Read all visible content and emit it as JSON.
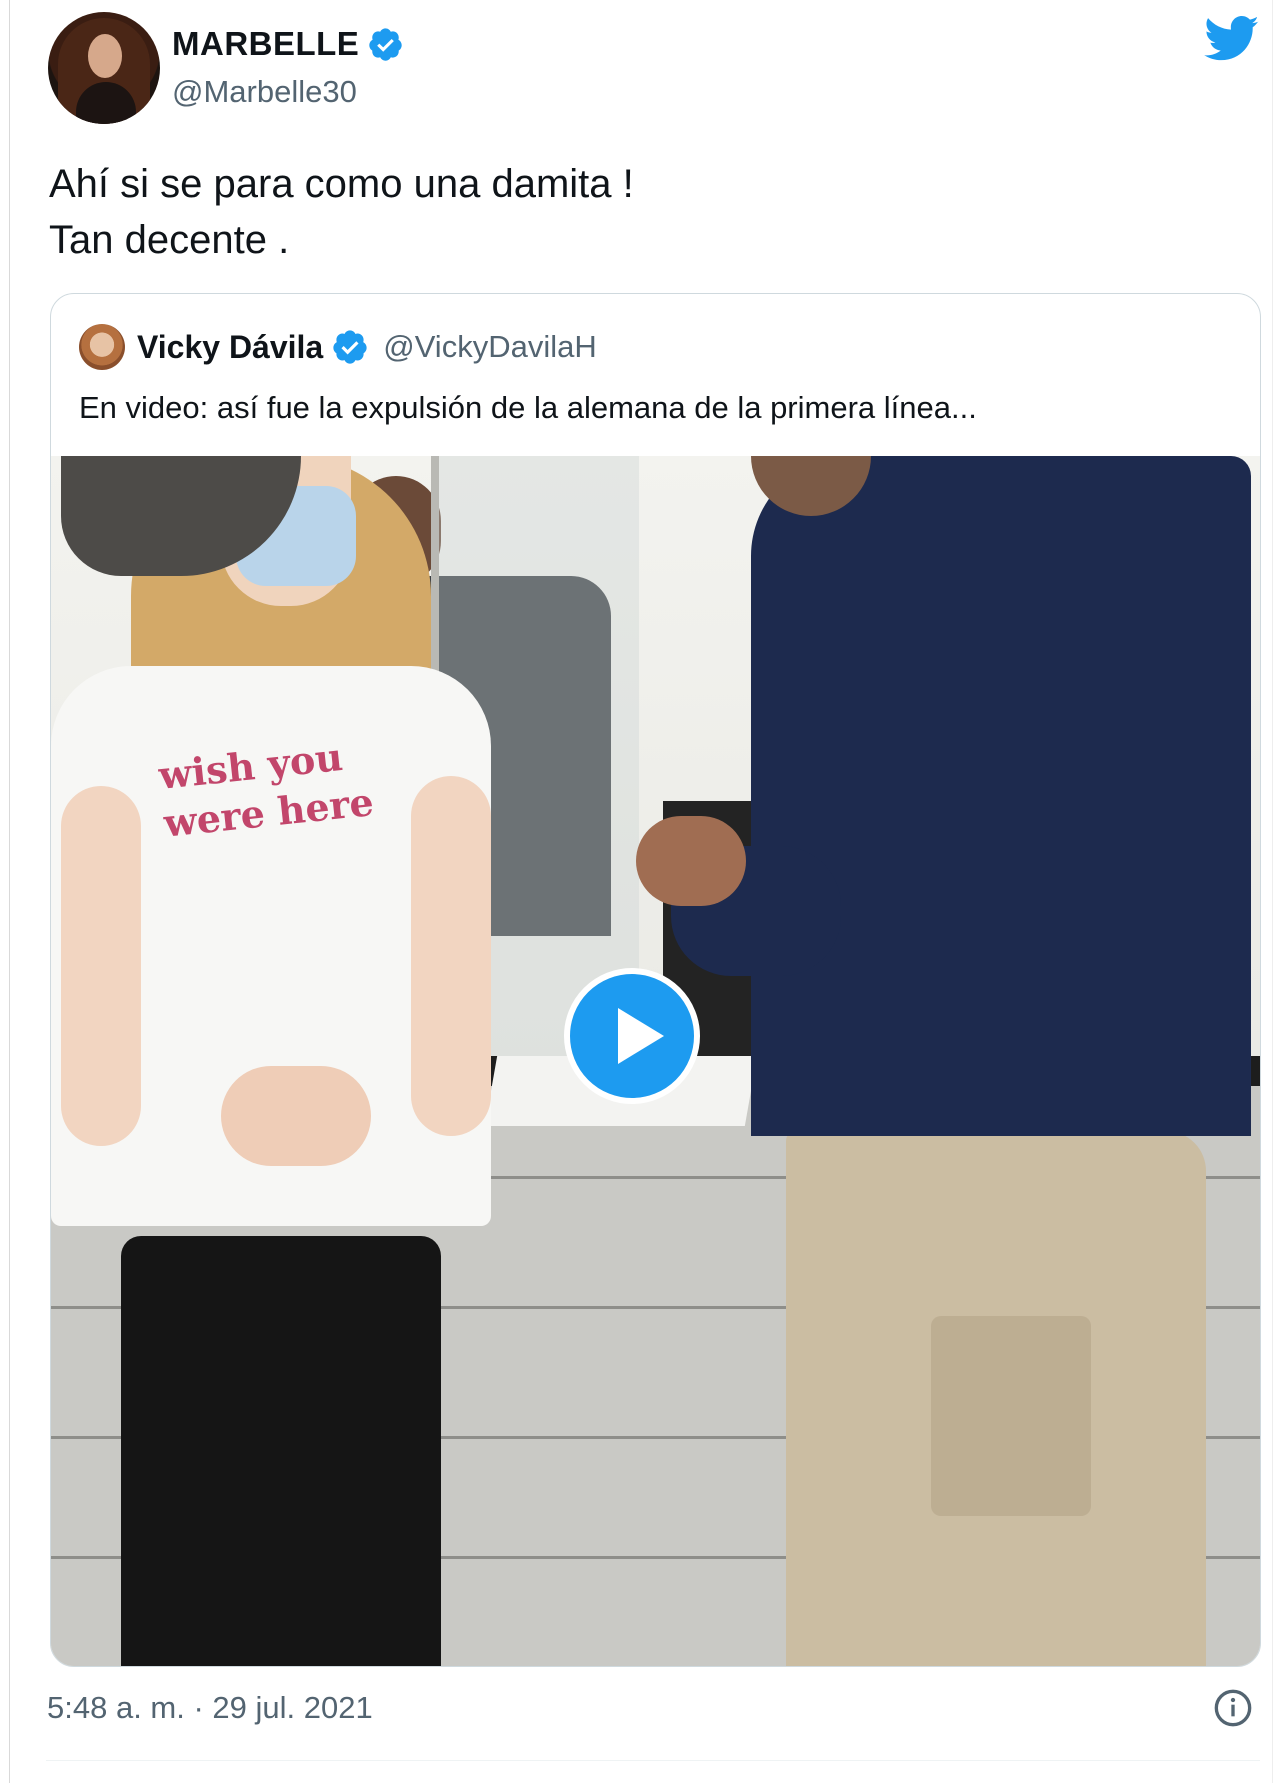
{
  "author": {
    "name": "MARBELLE",
    "handle": "@Marbelle30",
    "avatar_icon": "profile-photo"
  },
  "brand": {
    "icon": "twitter-bird-icon",
    "color": "#1d9bf0"
  },
  "tweet": {
    "lines": [
      "Ahí si se para como una damita !",
      "Tan decente ."
    ]
  },
  "quoted": {
    "name": "Vicky Dávila",
    "handle": "@VickyDavilaH",
    "text": "En video: así fue la expulsión de la alemana de la primera línea...",
    "media": {
      "type": "video",
      "shirt_text": [
        "wish you",
        "were here"
      ],
      "play_icon": "play-icon"
    }
  },
  "footer": {
    "timestamp": "5:48 a. m. · 29 jul. 2021",
    "info_icon": "info-icon"
  },
  "colors": {
    "verified": "#1d9bf0",
    "text_secondary": "#536471",
    "border": "#cfd9de"
  }
}
